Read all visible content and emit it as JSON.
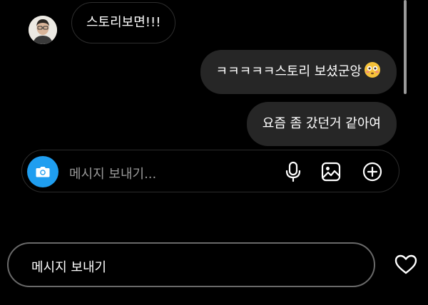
{
  "messages": [
    {
      "direction": "received",
      "text": "스토리보면!!!"
    },
    {
      "direction": "sent",
      "text": "ㅋㅋㅋㅋㅋ스토리 보셨군앙",
      "emoji": "flushed-face"
    },
    {
      "direction": "sent",
      "text": "요즘 좀 갔던거 같아여"
    }
  ],
  "composer": {
    "placeholder": "메시지 보내기...",
    "camera_color": "#1f9ef0",
    "icons": [
      "camera-icon",
      "microphone-icon",
      "image-icon",
      "plus-circle-icon"
    ]
  },
  "bottom_bar": {
    "placeholder": "메시지 보내기",
    "icon": "heart-icon"
  },
  "colors": {
    "background": "#000000",
    "sent_bubble": "#262626",
    "accent": "#1f9ef0"
  }
}
